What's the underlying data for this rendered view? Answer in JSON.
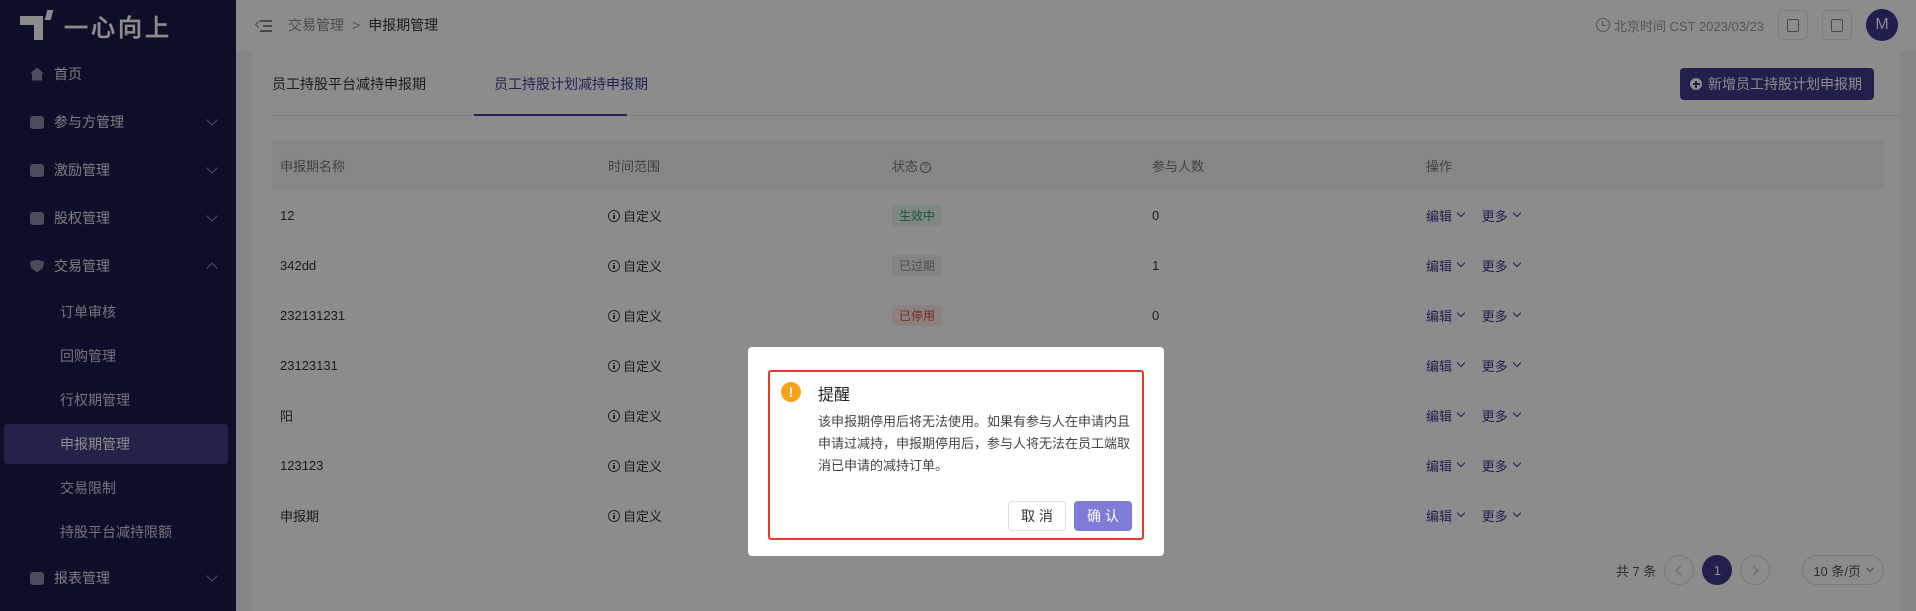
{
  "logo": {
    "text": "一心向上"
  },
  "sidebar": {
    "items": [
      {
        "label": "首页",
        "icon": "home-icon"
      },
      {
        "label": "参与方管理",
        "icon": "users-icon"
      },
      {
        "label": "激励管理",
        "icon": "gift-icon"
      },
      {
        "label": "股权管理",
        "icon": "pie-chart-icon"
      },
      {
        "label": "交易管理",
        "icon": "shield-icon",
        "expanded": true
      },
      {
        "label": "报表管理",
        "icon": "report-icon"
      }
    ],
    "submenu": [
      {
        "label": "订单审核"
      },
      {
        "label": "回购管理"
      },
      {
        "label": "行权期管理"
      },
      {
        "label": "申报期管理",
        "active": true
      },
      {
        "label": "交易限制"
      },
      {
        "label": "持股平台减持限额"
      }
    ]
  },
  "header": {
    "breadcrumb": [
      "交易管理",
      "申报期管理"
    ],
    "server_time": "北京时间 CST 2023/03/23",
    "avatar": "M"
  },
  "tabs": [
    {
      "label": "员工持股平台减持申报期"
    },
    {
      "label": "员工持股计划减持申报期",
      "active": true
    }
  ],
  "add_button": "新增员工持股计划申报期",
  "table": {
    "headers": [
      "申报期名称",
      "时间范围",
      "状态",
      "参与人数",
      "操作"
    ],
    "rows": [
      {
        "name": "12",
        "range": "自定义",
        "status": "生效中",
        "count": "0"
      },
      {
        "name": "342dd",
        "range": "自定义",
        "status": "已过期",
        "count": "1"
      },
      {
        "name": "232131231",
        "range": "自定义",
        "status": "已停用",
        "count": "0"
      },
      {
        "name": "23123131",
        "range": "自定义",
        "status": "",
        "count": ""
      },
      {
        "name": "阳",
        "range": "自定义",
        "status": "",
        "count": ""
      },
      {
        "name": "123123",
        "range": "自定义",
        "status": "",
        "count": ""
      },
      {
        "name": "申报期",
        "range": "自定义",
        "status": "",
        "count": ""
      }
    ],
    "op_edit": "编辑",
    "op_more": "更多"
  },
  "pagination": {
    "total": "共 7 条",
    "page": "1",
    "page_size": "10 条/页"
  },
  "status_colors": {
    "生效中": {
      "fg": "#2e9b5c",
      "bg": "#e6f6ec"
    },
    "已过期": {
      "fg": "#8a8a8a",
      "bg": "#f0f0f0"
    },
    "已停用": {
      "fg": "#e0473a",
      "bg": "#fdeceb"
    }
  },
  "dialog": {
    "title": "提醒",
    "body": "该申报期停用后将无法使用。如果有参与人在申请内且申请过减持，申报期停用后，参与人将无法在员工端取消已申请的减持订单。",
    "cancel": "取 消",
    "confirm": "确 认"
  }
}
